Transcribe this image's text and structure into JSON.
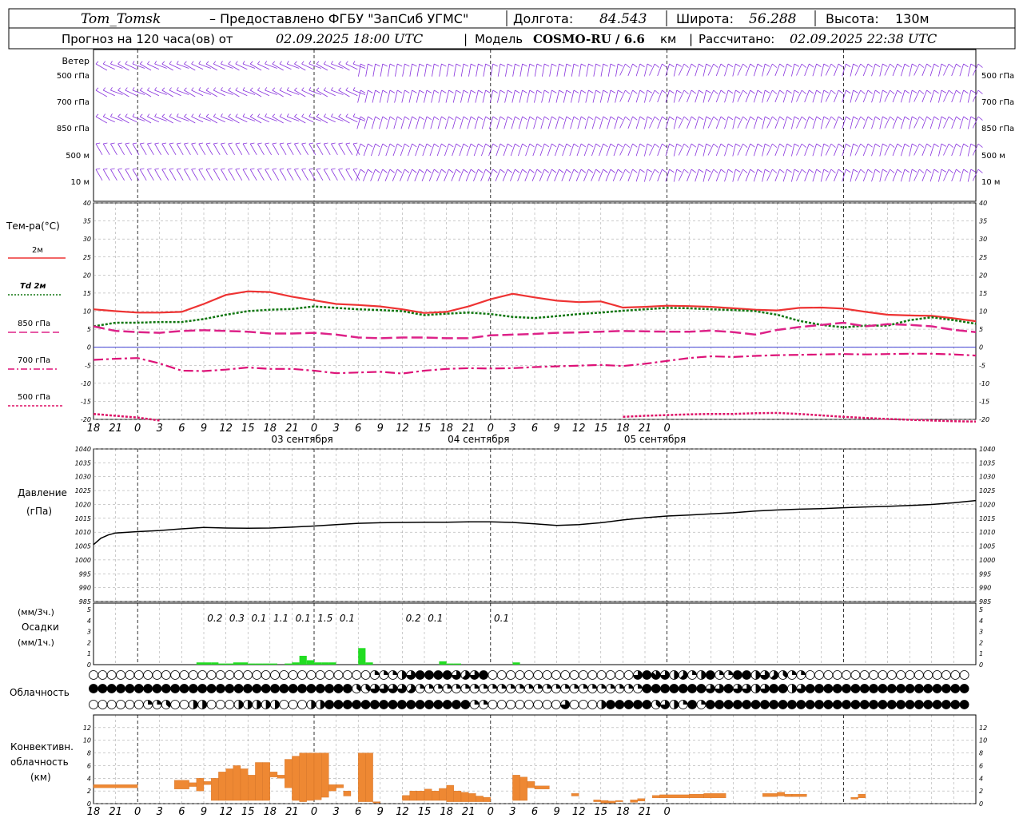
{
  "header": {
    "station": "Tom_Tomsk",
    "provider": "– Предоставлено ФГБУ \"ЗапСиб УГМС\"",
    "lon_label": "Долгота:",
    "lon": "84.543",
    "lat_label": "Широта:",
    "lat": "56.288",
    "alt_label": "Высота:",
    "alt": "130м",
    "forecast_label": "Прогноз на 120 часа(ов) от",
    "forecast_start": "02.09.2025 18:00 UTC",
    "model_label": "Модель",
    "model": "COSMO-RU / 6.6",
    "model_unit": "км",
    "computed_label": "Рассчитано:",
    "computed": "02.09.2025 22:38 UTC"
  },
  "colors": {
    "t2m": "#ee3333",
    "td2m": "#117711",
    "t850": "#dd2288",
    "t700": "#dd1177",
    "t500": "#dd1166",
    "zero": "#2222cc",
    "precip": "#22dd22",
    "conv": "#ee8833",
    "wind": "#8833dd",
    "pressure": "#000000",
    "grid": "#999999"
  },
  "time_axis": {
    "hour_labels": [
      "18",
      "21",
      "0",
      "3",
      "6",
      "9",
      "12",
      "15",
      "18",
      "21",
      "0",
      "3",
      "6",
      "9",
      "12",
      "15",
      "18",
      "21",
      "0",
      "3",
      "6",
      "9",
      "12",
      "15",
      "18",
      "21",
      "0"
    ],
    "days": [
      "03 сентября",
      "04 сентября",
      "05 сентября"
    ]
  },
  "wind_panel": {
    "title": "Ветер",
    "levels": [
      "500 гПа",
      "700 гПа",
      "850 гПа",
      "500 м",
      "10  м"
    ],
    "icon": "wind-barb-icon"
  },
  "chart_data": [
    {
      "id": "temperature",
      "type": "line",
      "title": "Тем-ра(°C)",
      "ylim": [
        -20,
        40
      ],
      "yticks": [
        -20,
        -15,
        -10,
        -5,
        0,
        5,
        10,
        15,
        20,
        25,
        30,
        35,
        40
      ],
      "x_hours": [
        0,
        3,
        6,
        9,
        12,
        15,
        18,
        21,
        24,
        27,
        30,
        33,
        36,
        39,
        42,
        45,
        48,
        51,
        54,
        57,
        60,
        63,
        66,
        69,
        72,
        75,
        78,
        81,
        84,
        87,
        90,
        93,
        96,
        99,
        102,
        105,
        108,
        111,
        114,
        117,
        120
      ],
      "series": [
        {
          "name": "2м",
          "style": "solid",
          "color": "#ee3333",
          "values": [
            10.5,
            10,
            9.6,
            9.6,
            9.8,
            12,
            14.5,
            15.5,
            15.3,
            14,
            13,
            12,
            11.7,
            11.3,
            10.5,
            9.5,
            9.8,
            11.3,
            13.3,
            14.8,
            13.8,
            12.9,
            12.5,
            12.7,
            11,
            11.2,
            11.5,
            11.4,
            11.2,
            10.8,
            10.4,
            10.2,
            10.9,
            11,
            10.7,
            9.8,
            9,
            8.8,
            8.7,
            8,
            7.2
          ]
        },
        {
          "name": "Td  2м",
          "style": "dotted",
          "color": "#117711",
          "values": [
            5.8,
            6.8,
            6.8,
            7,
            7,
            7.8,
            9,
            10,
            10.4,
            10.6,
            11.3,
            10.9,
            10.5,
            10.3,
            10,
            8.9,
            9.3,
            9.6,
            9.2,
            8.4,
            8.1,
            8.6,
            9.2,
            9.6,
            10.1,
            10.5,
            10.9,
            10.8,
            10.5,
            10.3,
            10,
            9,
            7.3,
            6.2,
            5.5,
            6,
            6,
            7.5,
            8.3,
            7.5,
            6.5
          ]
        },
        {
          "name": "850 гПа",
          "style": "longdash",
          "color": "#dd2288",
          "values": [
            5.8,
            4.5,
            4.2,
            4,
            4.5,
            4.7,
            4.5,
            4.3,
            3.8,
            3.8,
            4,
            3.5,
            2.7,
            2.5,
            2.7,
            2.7,
            2.5,
            2.5,
            3.3,
            3.5,
            3.7,
            4,
            4.1,
            4.3,
            4.5,
            4.4,
            4.3,
            4.3,
            4.6,
            4.2,
            3.5,
            4.8,
            5.6,
            6.2,
            6.8,
            5.8,
            6.4,
            6.2,
            5.8,
            4.8,
            4.2
          ]
        },
        {
          "name": "700 гПа",
          "style": "dashdot",
          "color": "#dd1177",
          "values": [
            -3.5,
            -3.2,
            -3,
            -4.5,
            -6.5,
            -6.6,
            -6.2,
            -5.6,
            -6,
            -6,
            -6.5,
            -7.2,
            -7,
            -6.8,
            -7.3,
            -6.5,
            -6,
            -5.8,
            -5.9,
            -5.8,
            -5.5,
            -5.3,
            -5.1,
            -4.9,
            -5.2,
            -4.6,
            -3.8,
            -3,
            -2.5,
            -2.7,
            -2.4,
            -2.2,
            -2.1,
            -2,
            -1.9,
            -2,
            -1.9,
            -1.8,
            -1.8,
            -2,
            -2.3
          ]
        },
        {
          "name": "500 гПа",
          "style": "shortdash",
          "color": "#dd1166",
          "values": [
            -18.5,
            -19,
            -19.5,
            -20.3,
            null,
            null,
            null,
            null,
            null,
            null,
            null,
            null,
            null,
            null,
            null,
            null,
            null,
            null,
            null,
            null,
            null,
            null,
            null,
            null,
            -19.3,
            -19,
            -18.8,
            -18.6,
            -18.5,
            -18.5,
            -18.3,
            -18.2,
            -18.5,
            -18.9,
            -19.3,
            -19.6,
            -19.9,
            -20.1,
            -20.3,
            -20.5,
            -20.6
          ]
        }
      ]
    },
    {
      "id": "pressure",
      "type": "line",
      "title": "Давление",
      "ylabel": "(гПа)",
      "ylim": [
        985,
        1040
      ],
      "yticks": [
        985,
        990,
        995,
        1000,
        1005,
        1010,
        1015,
        1020,
        1025,
        1030,
        1035,
        1040
      ],
      "x_hours": [
        0,
        1,
        2,
        3,
        6,
        9,
        12,
        15,
        18,
        21,
        24,
        27,
        30,
        33,
        36,
        39,
        42,
        45,
        48,
        51,
        54,
        57,
        60,
        63,
        66,
        69,
        72,
        75,
        78,
        81,
        84,
        87,
        90,
        93,
        96,
        99,
        102,
        105,
        108,
        111,
        114,
        117,
        120
      ],
      "series": [
        {
          "name": "Давление",
          "values": [
            1005.5,
            1007.8,
            1009,
            1009.7,
            1010.2,
            1010.6,
            1011.2,
            1011.7,
            1011.5,
            1011.4,
            1011.5,
            1011.8,
            1012.2,
            1012.7,
            1013.2,
            1013.4,
            1013.5,
            1013.6,
            1013.6,
            1013.7,
            1013.7,
            1013.5,
            1013,
            1012.4,
            1012.7,
            1013.4,
            1014.4,
            1015.2,
            1015.8,
            1016.2,
            1016.6,
            1017,
            1017.6,
            1018,
            1018.3,
            1018.5,
            1018.8,
            1019.1,
            1019.3,
            1019.6,
            1020,
            1020.6,
            1021.4
          ]
        }
      ]
    },
    {
      "id": "precipitation",
      "type": "bar",
      "title": "Осадки",
      "ylabel_top": "(мм/3ч.)",
      "ylabel_bottom": "(мм/1ч.)",
      "ylim": [
        0,
        5
      ],
      "yticks": [
        0,
        1,
        2,
        3,
        4,
        5
      ],
      "hourly": [
        {
          "h": 15,
          "v": 0.2
        },
        {
          "h": 16,
          "v": 0.2
        },
        {
          "h": 17,
          "v": 0.2
        },
        {
          "h": 18,
          "v": 0.1
        },
        {
          "h": 19,
          "v": 0.1
        },
        {
          "h": 20,
          "v": 0.2
        },
        {
          "h": 21,
          "v": 0.2
        },
        {
          "h": 22,
          "v": 0.1
        },
        {
          "h": 23,
          "v": 0.1
        },
        {
          "h": 24,
          "v": 0.1
        },
        {
          "h": 25,
          "v": 0.1
        },
        {
          "h": 27,
          "v": 0.1
        },
        {
          "h": 28,
          "v": 0.2
        },
        {
          "h": 29,
          "v": 0.8
        },
        {
          "h": 30,
          "v": 0.4
        },
        {
          "h": 31,
          "v": 0.2
        },
        {
          "h": 32,
          "v": 0.2
        },
        {
          "h": 33,
          "v": 0.2
        },
        {
          "h": 37,
          "v": 1.5
        },
        {
          "h": 38,
          "v": 0.2
        },
        {
          "h": 48,
          "v": 0.3
        },
        {
          "h": 49,
          "v": 0.1
        },
        {
          "h": 50,
          "v": 0.1
        },
        {
          "h": 58,
          "v": 0.2
        }
      ],
      "totals_3h": [
        {
          "h": 16.5,
          "label": "0.2"
        },
        {
          "h": 19.5,
          "label": "0.3"
        },
        {
          "h": 22.5,
          "label": "0.1"
        },
        {
          "h": 25.5,
          "label": "1.1"
        },
        {
          "h": 28.5,
          "label": "0.1"
        },
        {
          "h": 31.5,
          "label": "1.5"
        },
        {
          "h": 34.5,
          "label": "0.1"
        },
        {
          "h": 43.5,
          "label": "0.2"
        },
        {
          "h": 46.5,
          "label": "0.1"
        },
        {
          "h": 55.5,
          "label": "0.1"
        }
      ]
    },
    {
      "id": "cloudiness",
      "type": "table",
      "title": "Облачность",
      "rows": [
        "0000000000000000000000000000000222468888656800000000000000006876452482288465322000000000000000000",
        "8888888888888888888888888888833666652222222222222222222222222888888866866468846888888888888888888",
        "0000002230044000444440004488888888888888882200000000600048888836428288888888888888888888888888888"
      ]
    },
    {
      "id": "convective",
      "type": "bar",
      "title": "Конвективн.",
      "subtitle": "облачность",
      "ylabel": "(км)",
      "ylim": [
        0,
        14
      ],
      "yticks": [
        0,
        2,
        4,
        6,
        8,
        10,
        12
      ],
      "segments": [
        {
          "x0": 0,
          "x1": 6,
          "b": 2.5,
          "t": 3
        },
        {
          "x0": 11,
          "x1": 13,
          "b": 2.3,
          "t": 3.7
        },
        {
          "x0": 13,
          "x1": 14,
          "b": 2.7,
          "t": 3.3
        },
        {
          "x0": 14,
          "x1": 15,
          "b": 2,
          "t": 4
        },
        {
          "x0": 15,
          "x1": 16,
          "b": 3,
          "t": 3.5
        },
        {
          "x0": 16,
          "x1": 17,
          "b": 0.5,
          "t": 4
        },
        {
          "x0": 17,
          "x1": 18,
          "b": 0.5,
          "t": 5
        },
        {
          "x0": 18,
          "x1": 19,
          "b": 0.5,
          "t": 5.5
        },
        {
          "x0": 19,
          "x1": 20,
          "b": 0.5,
          "t": 6
        },
        {
          "x0": 20,
          "x1": 21,
          "b": 0.5,
          "t": 5.5
        },
        {
          "x0": 21,
          "x1": 22,
          "b": 0.5,
          "t": 4.5
        },
        {
          "x0": 22,
          "x1": 23,
          "b": 0.5,
          "t": 6.5
        },
        {
          "x0": 23,
          "x1": 24,
          "b": 0.5,
          "t": 6.5
        },
        {
          "x0": 24,
          "x1": 25,
          "b": 4.2,
          "t": 5
        },
        {
          "x0": 25,
          "x1": 26,
          "b": 4,
          "t": 4.5
        },
        {
          "x0": 26,
          "x1": 27,
          "b": 2.5,
          "t": 7
        },
        {
          "x0": 27,
          "x1": 28,
          "b": 0.5,
          "t": 7.5
        },
        {
          "x0": 28,
          "x1": 29,
          "b": 0.3,
          "t": 8
        },
        {
          "x0": 29,
          "x1": 30,
          "b": 0.5,
          "t": 8
        },
        {
          "x0": 30,
          "x1": 31,
          "b": 0.6,
          "t": 8
        },
        {
          "x0": 31,
          "x1": 32,
          "b": 1,
          "t": 8
        },
        {
          "x0": 32,
          "x1": 33,
          "b": 2,
          "t": 3
        },
        {
          "x0": 33,
          "x1": 34,
          "b": 2.5,
          "t": 3
        },
        {
          "x0": 34,
          "x1": 35,
          "b": 1.2,
          "t": 2
        },
        {
          "x0": 36,
          "x1": 37,
          "b": 0.3,
          "t": 8
        },
        {
          "x0": 37,
          "x1": 38,
          "b": 0.3,
          "t": 8
        },
        {
          "x0": 38,
          "x1": 39,
          "b": 0.1,
          "t": 0.3
        },
        {
          "x0": 42,
          "x1": 43,
          "b": 0.5,
          "t": 1.3
        },
        {
          "x0": 43,
          "x1": 44,
          "b": 0.5,
          "t": 2
        },
        {
          "x0": 44,
          "x1": 45,
          "b": 0.5,
          "t": 2
        },
        {
          "x0": 45,
          "x1": 46,
          "b": 0.5,
          "t": 2.3
        },
        {
          "x0": 46,
          "x1": 47,
          "b": 0.5,
          "t": 2
        },
        {
          "x0": 47,
          "x1": 48,
          "b": 0.5,
          "t": 2.4
        },
        {
          "x0": 48,
          "x1": 49,
          "b": 0.3,
          "t": 2.9
        },
        {
          "x0": 49,
          "x1": 50,
          "b": 0.3,
          "t": 2
        },
        {
          "x0": 50,
          "x1": 51,
          "b": 0.3,
          "t": 1.8
        },
        {
          "x0": 51,
          "x1": 52,
          "b": 0.3,
          "t": 1.6
        },
        {
          "x0": 52,
          "x1": 53,
          "b": 0.3,
          "t": 1.2
        },
        {
          "x0": 53,
          "x1": 54,
          "b": 0.3,
          "t": 1
        },
        {
          "x0": 57,
          "x1": 58,
          "b": 0.5,
          "t": 4.5
        },
        {
          "x0": 58,
          "x1": 59,
          "b": 0.5,
          "t": 4.2
        },
        {
          "x0": 59,
          "x1": 60,
          "b": 2.5,
          "t": 3.5
        },
        {
          "x0": 60,
          "x1": 62,
          "b": 2.3,
          "t": 2.8
        },
        {
          "x0": 65,
          "x1": 66,
          "b": 1.2,
          "t": 1.6
        },
        {
          "x0": 68,
          "x1": 69,
          "b": 0.3,
          "t": 0.6
        },
        {
          "x0": 69,
          "x1": 70,
          "b": 0.1,
          "t": 0.5
        },
        {
          "x0": 70,
          "x1": 71,
          "b": 0.1,
          "t": 0.4
        },
        {
          "x0": 71,
          "x1": 72,
          "b": 0.3,
          "t": 0.5
        },
        {
          "x0": 73,
          "x1": 74,
          "b": 0.2,
          "t": 0.6
        },
        {
          "x0": 74,
          "x1": 75,
          "b": 0.4,
          "t": 0.8
        },
        {
          "x0": 76,
          "x1": 77,
          "b": 0.9,
          "t": 1.3
        },
        {
          "x0": 77,
          "x1": 81,
          "b": 0.9,
          "t": 1.4
        },
        {
          "x0": 81,
          "x1": 83,
          "b": 0.9,
          "t": 1.5
        },
        {
          "x0": 83,
          "x1": 86,
          "b": 0.9,
          "t": 1.6
        },
        {
          "x0": 91,
          "x1": 93,
          "b": 1.1,
          "t": 1.6
        },
        {
          "x0": 93,
          "x1": 94,
          "b": 1.2,
          "t": 1.8
        },
        {
          "x0": 94,
          "x1": 95,
          "b": 1.1,
          "t": 1.5
        },
        {
          "x0": 95,
          "x1": 97,
          "b": 1.1,
          "t": 1.5
        },
        {
          "x0": 103,
          "x1": 104,
          "b": 0.7,
          "t": 1
        },
        {
          "x0": 104,
          "x1": 105,
          "b": 0.9,
          "t": 1.5
        }
      ]
    }
  ]
}
